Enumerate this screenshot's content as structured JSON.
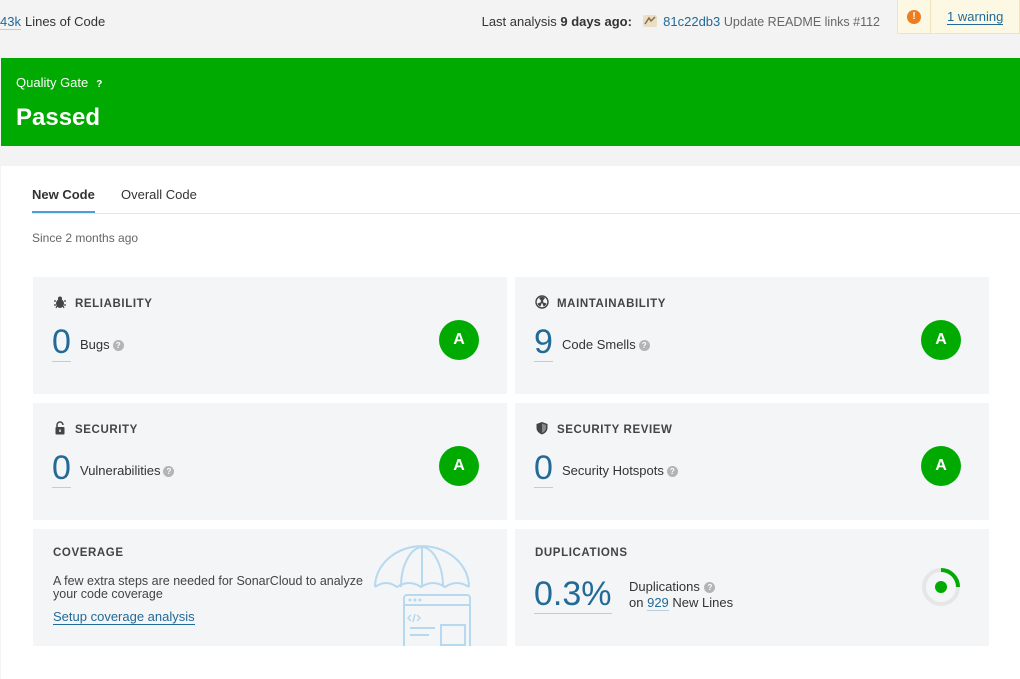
{
  "topbar": {
    "loc_value": "43k",
    "loc_label": "Lines of Code",
    "analysis_prefix": "Last analysis",
    "analysis_age": "9 days ago:",
    "commit_hash": "81c22db3",
    "commit_message": "Update README links #112",
    "warning_link": "1 warning"
  },
  "quality_gate": {
    "title": "Quality Gate",
    "help": "?",
    "status": "Passed",
    "color": "#00aa00"
  },
  "tabs": [
    {
      "label": "New Code",
      "active": true
    },
    {
      "label": "Overall Code",
      "active": false
    }
  ],
  "since": "Since 2 months ago",
  "cards": {
    "reliability": {
      "title": "RELIABILITY",
      "value": "0",
      "label": "Bugs",
      "grade": "A",
      "icon": "bug-icon"
    },
    "maintainability": {
      "title": "MAINTAINABILITY",
      "value": "9",
      "label": "Code Smells",
      "grade": "A",
      "icon": "radiation-icon"
    },
    "security": {
      "title": "SECURITY",
      "value": "0",
      "label": "Vulnerabilities",
      "grade": "A",
      "icon": "lock-icon"
    },
    "security_review": {
      "title": "SECURITY REVIEW",
      "value": "0",
      "label": "Security Hotspots",
      "grade": "A",
      "icon": "shield-icon"
    },
    "coverage": {
      "title": "COVERAGE",
      "text": "A few extra steps are needed for SonarCloud to analyze your code coverage",
      "link": "Setup coverage analysis",
      "icon": "umbrella-illustration"
    },
    "duplications": {
      "title": "DUPLICATIONS",
      "value": "0.3%",
      "label": "Duplications",
      "on": "on",
      "lines": "929",
      "lines_label": "New Lines",
      "ratio": 0.003
    }
  },
  "colors": {
    "grade_a": "#00aa00",
    "link": "#236a97",
    "warning": "#ed7d20"
  }
}
